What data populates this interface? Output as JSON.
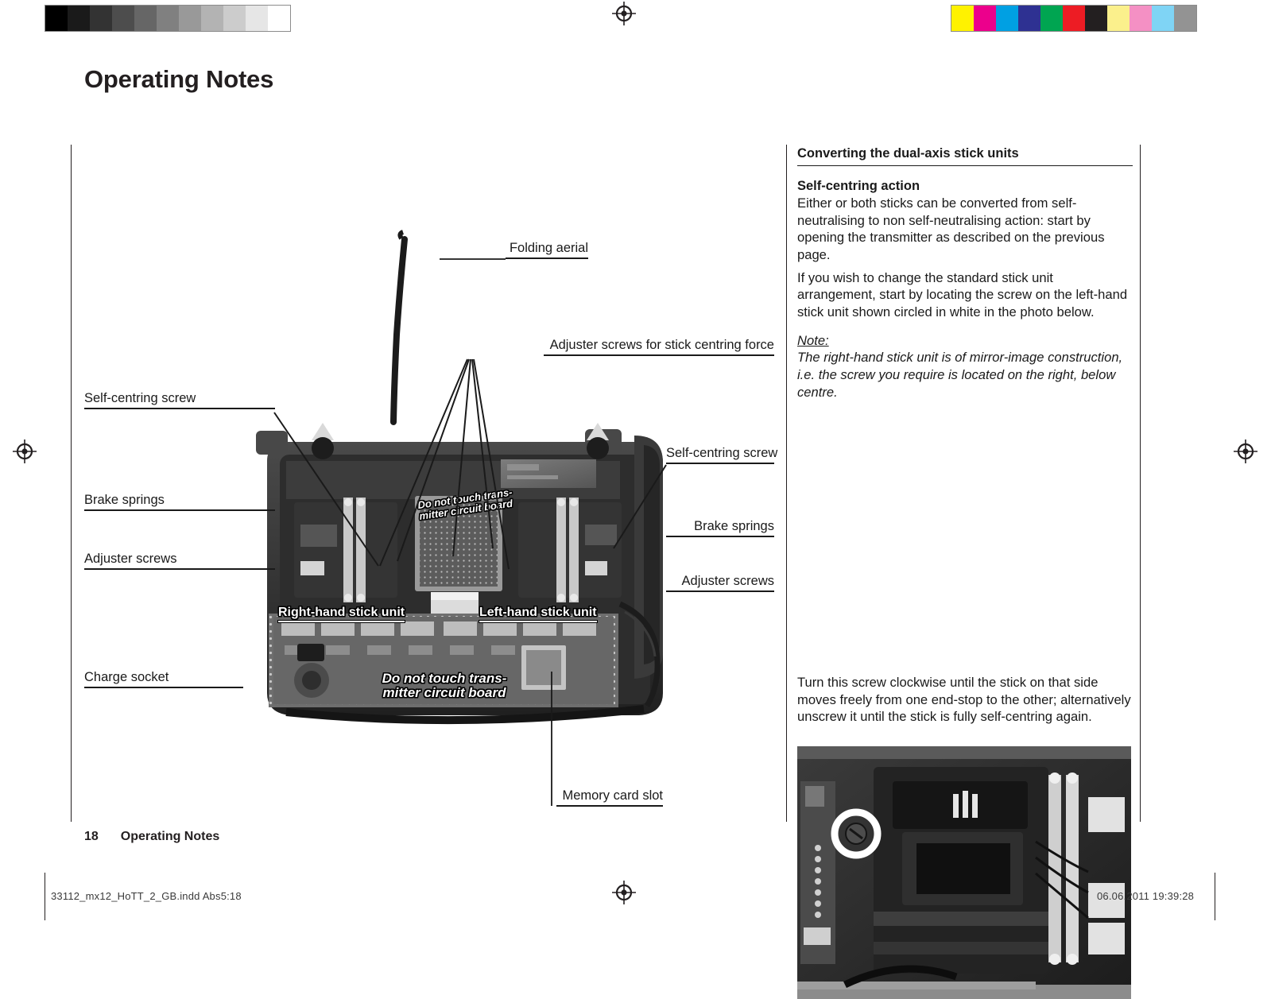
{
  "header": {
    "title": "Operating Notes"
  },
  "footer": {
    "page_number": "18",
    "section": "Operating Notes",
    "print_file": "33112_mx12_HoTT_2_GB.indd   Abs5:18",
    "print_date": "06.06.2011   19:39:28"
  },
  "calibration": {
    "greyscale": [
      "#000000",
      "#1a1a1a",
      "#333333",
      "#4d4d4d",
      "#666666",
      "#808080",
      "#999999",
      "#b3b3b3",
      "#cccccc",
      "#e6e6e6",
      "#ffffff"
    ],
    "colours": [
      "#fff200",
      "#ec008c",
      "#00a0e3",
      "#2e3192",
      "#00a551",
      "#ed1c24",
      "#231f20",
      "#fbf08c",
      "#f490c4",
      "#7fd4f5",
      "#939393"
    ]
  },
  "right_column": {
    "heading": "Converting the dual-axis stick units",
    "subheading": "Self-centring action",
    "paragraph_1": "Either or both sticks can be converted from self-neutralising to non self-neutralising action: start by opening the transmitter as described on the previous page.",
    "paragraph_2": "If you wish to change the standard stick unit arrangement, start by locating the screw on the left-hand stick unit shown circled in white in the photo below.",
    "note_label": "Note:",
    "note_body": "The right-hand stick unit is of mirror-image construction, i.e. the screw you require is located on the right, below centre.",
    "paragraph_3": "Turn this screw clockwise until the stick on that side moves freely from one end-stop to the other; alternatively unscrew it until the stick is fully self-centring again."
  },
  "diagram": {
    "callouts_left": [
      {
        "label": "Self-centring screw"
      },
      {
        "label": "Brake springs"
      },
      {
        "label": "Adjuster screws"
      },
      {
        "label": "Charge socket"
      }
    ],
    "callouts_right": [
      {
        "label": "Folding aerial"
      },
      {
        "label": "Adjuster screws for stick centring force"
      },
      {
        "label": "Self-centring screw"
      },
      {
        "label": "Brake springs"
      },
      {
        "label": "Adjuster screws"
      },
      {
        "label": "Memory card slot"
      }
    ],
    "photo_labels": [
      {
        "label": "Right-hand stick unit"
      },
      {
        "label": "Left-hand stick unit"
      },
      {
        "label": "Do not touch trans-"
      },
      {
        "label": "mitter circuit board"
      },
      {
        "label": "Do not touch trans-"
      },
      {
        "label": "mitter circuit board"
      }
    ]
  }
}
